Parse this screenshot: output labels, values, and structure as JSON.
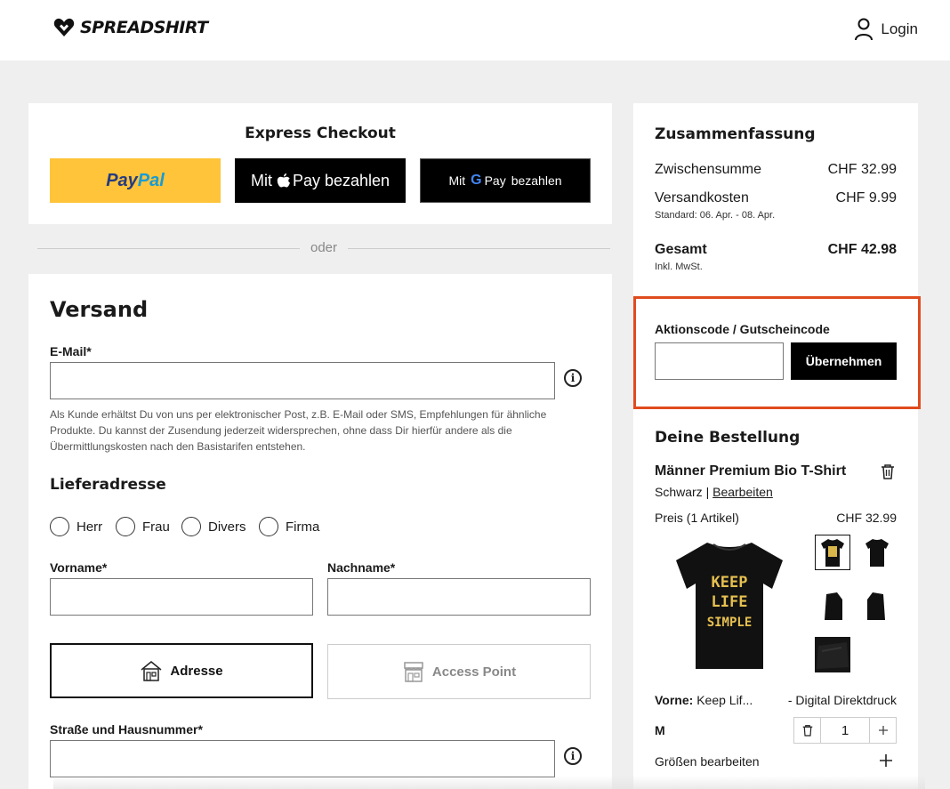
{
  "header": {
    "brand": "SPREADSHIRT",
    "login_label": "Login"
  },
  "express": {
    "title": "Express Checkout",
    "paypal_label_1": "Pay",
    "paypal_label_2": "Pal",
    "apple_label_pre": "Mit",
    "apple_label_post": "Pay bezahlen",
    "google_label_pre": "Mit",
    "google_label_mid": "Pay",
    "google_label_post": "bezahlen"
  },
  "divider_text": "oder",
  "shipping": {
    "title": "Versand",
    "email_label": "E-Mail*",
    "email_value": "",
    "email_hint": [
      "Als Kunde erhältst Du von uns per elektronischer Post, z.B. E-Mail oder SMS, Empfehlungen für ähnliche",
      "Produkte. Du kannst der Zusendung jederzeit widersprechen, ohne dass Dir hierfür andere als die",
      "Übermittlungskosten nach den Basistarifen entstehen."
    ],
    "address_title": "Lieferadresse",
    "salutations": [
      "Herr",
      "Frau",
      "Divers",
      "Firma"
    ],
    "firstname_label": "Vorname*",
    "lastname_label": "Nachname*",
    "option_address": "Adresse",
    "option_access_point": "Access Point",
    "street_label": "Straße und Hausnummer*"
  },
  "summary": {
    "title": "Zusammenfassung",
    "subtotal_label": "Zwischensumme",
    "subtotal_value": "CHF 32.99",
    "shipping_label": "Versandkosten",
    "shipping_value": "CHF 9.99",
    "shipping_note": "Standard: 06. Apr. - 08. Apr.",
    "total_label": "Gesamt",
    "total_value": "CHF 42.98",
    "total_note": "Inkl. MwSt."
  },
  "promo": {
    "label": "Aktionscode / Gutscheincode",
    "input_value": "",
    "button_label": "Übernehmen",
    "highlight_color": "#e04b1e"
  },
  "order": {
    "title": "Deine Bestellung",
    "product_name": "Männer Premium Bio T-Shirt",
    "color": "Schwarz",
    "separator": "|",
    "edit_label": "Bearbeiten",
    "price_label": "Preis (1 Artikel)",
    "price_value": "CHF 32.99",
    "print_side": "Vorne:",
    "print_name": "Keep Lif...",
    "print_method": "- Digital Direktdruck",
    "size": "M",
    "quantity": "1",
    "edit_sizes_label": "Größen bearbeiten",
    "design_text": [
      "KEEP",
      "LIFE",
      "SIMPLE"
    ]
  }
}
